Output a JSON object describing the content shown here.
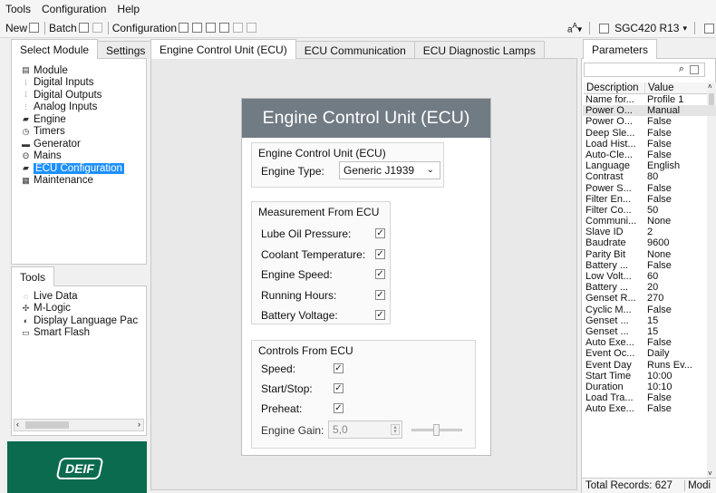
{
  "menu": {
    "items": [
      "Tools",
      "Configuration",
      "Help"
    ]
  },
  "toolbar": {
    "new_label": "New",
    "batch_label": "Batch",
    "configuration_label": "Configuration",
    "device_label": "SGC420 R13"
  },
  "left_panel": {
    "tabs": [
      "Select Module",
      "Settings"
    ],
    "tree": [
      {
        "label": "Module",
        "icon": "module-icon"
      },
      {
        "label": "Digital Inputs",
        "icon": "digital-inputs-icon"
      },
      {
        "label": "Digital Outputs",
        "icon": "digital-outputs-icon"
      },
      {
        "label": "Analog Inputs",
        "icon": "analog-inputs-icon"
      },
      {
        "label": "Engine",
        "icon": "engine-icon"
      },
      {
        "label": "Timers",
        "icon": "timer-icon"
      },
      {
        "label": "Generator",
        "icon": "generator-icon"
      },
      {
        "label": "Mains",
        "icon": "mains-icon"
      },
      {
        "label": "ECU Configuration",
        "icon": "ecu-icon"
      },
      {
        "label": "Maintenance",
        "icon": "maintenance-icon"
      }
    ],
    "selected": "ECU Configuration"
  },
  "tools_panel": {
    "tab": "Tools",
    "items": [
      {
        "label": "Live Data",
        "icon": "live-data-icon"
      },
      {
        "label": "M-Logic",
        "icon": "m-logic-icon"
      },
      {
        "label": "Display Language Pac",
        "icon": "language-icon"
      },
      {
        "label": "Smart Flash",
        "icon": "flash-icon"
      }
    ]
  },
  "logo": {
    "text": "DEIF",
    "bg": "#0a6b4f"
  },
  "main": {
    "tabs": [
      "Engine Control Unit (ECU)",
      "ECU Communication",
      "ECU Diagnostic Lamps"
    ],
    "active_tab": 0,
    "dialog_title": "Engine Control Unit (ECU)",
    "group_ecu": {
      "title": "Engine Control Unit (ECU)",
      "engine_type_label": "Engine Type:",
      "engine_type_value": "Generic J1939"
    },
    "group_measurement": {
      "title": "Measurement From ECU",
      "items": [
        {
          "label": "Lube Oil Pressure:",
          "checked": true
        },
        {
          "label": "Coolant Temperature:",
          "checked": true
        },
        {
          "label": "Engine Speed:",
          "checked": true
        },
        {
          "label": "Running Hours:",
          "checked": true
        },
        {
          "label": "Battery Voltage:",
          "checked": true
        }
      ]
    },
    "group_controls": {
      "title": "Controls From ECU",
      "items": [
        {
          "label": "Speed:",
          "checked": true
        },
        {
          "label": "Start/Stop:",
          "checked": true
        },
        {
          "label": "Preheat:",
          "checked": true
        }
      ],
      "engine_gain_label": "Engine Gain:",
      "engine_gain_value": "5,0"
    }
  },
  "parameters": {
    "tab": "Parameters",
    "header": [
      "Description",
      "Value"
    ],
    "rows": [
      [
        "Name for...",
        "Profile 1"
      ],
      [
        "Power O...",
        "Manual"
      ],
      [
        "Power O...",
        "False"
      ],
      [
        "Deep Sle...",
        "False"
      ],
      [
        "Load Hist...",
        "False"
      ],
      [
        "Auto-Cle...",
        "False"
      ],
      [
        "Language",
        "English"
      ],
      [
        "Contrast",
        "80"
      ],
      [
        "Power S...",
        "False"
      ],
      [
        "Filter En...",
        "False"
      ],
      [
        "Filter Co...",
        "50"
      ],
      [
        "Communi...",
        "None"
      ],
      [
        "Slave ID",
        "2"
      ],
      [
        "Baudrate",
        "9600"
      ],
      [
        "Parity Bit",
        "None"
      ],
      [
        "Battery ...",
        "False"
      ],
      [
        "Low Volt...",
        "60"
      ],
      [
        "Battery ...",
        "20"
      ],
      [
        "Genset R...",
        "270"
      ],
      [
        "Cyclic M...",
        "False"
      ],
      [
        "Genset ...",
        "15"
      ],
      [
        "Genset ...",
        "15"
      ],
      [
        "Auto Exe...",
        "False"
      ],
      [
        "Event Oc...",
        "Daily"
      ],
      [
        "Event Day",
        "Runs Ev..."
      ],
      [
        "Start Time",
        "10:00"
      ],
      [
        "Duration",
        "10:10"
      ],
      [
        "Load Tra...",
        "False"
      ],
      [
        "Auto Exe...",
        "False"
      ]
    ],
    "highlighted_row": 1,
    "footer": "Total Records: 627",
    "footer_right": "Modi"
  }
}
